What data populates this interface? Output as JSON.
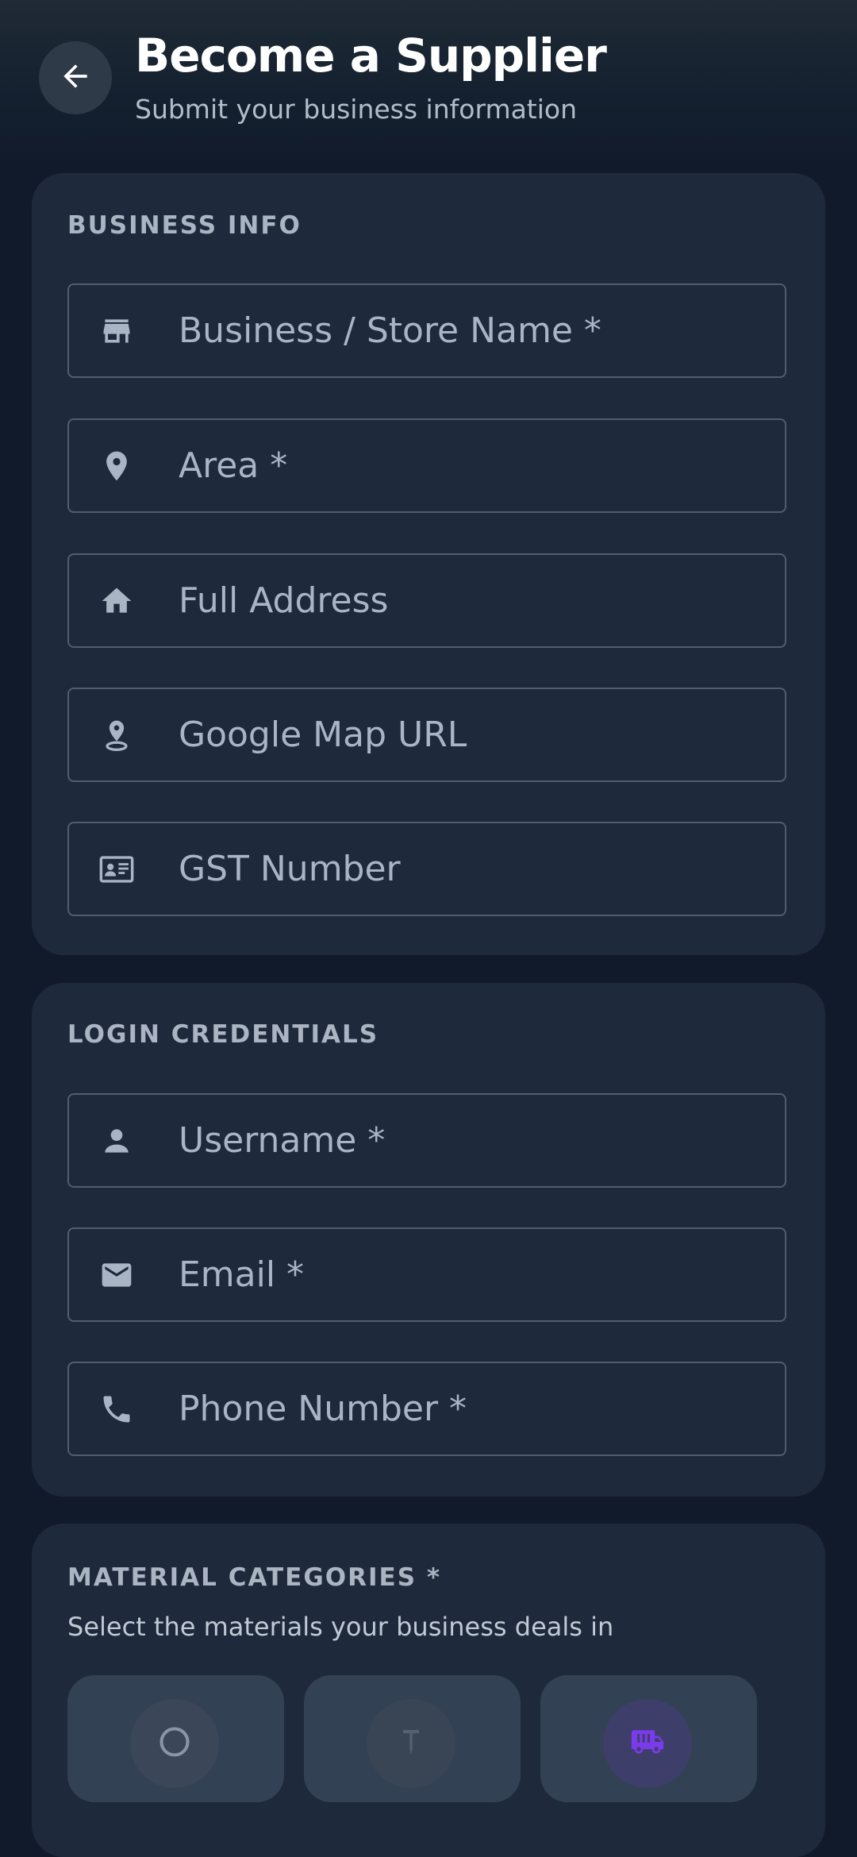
{
  "header": {
    "title": "Become a Supplier",
    "subtitle": "Submit your business information",
    "back_icon": "arrow-left-icon"
  },
  "business_info": {
    "section_title": "BUSINESS INFO",
    "fields": [
      {
        "icon": "store-icon",
        "placeholder": "Business / Store Name *"
      },
      {
        "icon": "location-pin-icon",
        "placeholder": "Area *"
      },
      {
        "icon": "home-icon",
        "placeholder": "Full Address"
      },
      {
        "icon": "map-pin-icon",
        "placeholder": "Google Map URL"
      },
      {
        "icon": "id-card-icon",
        "placeholder": "GST Number"
      }
    ]
  },
  "login_credentials": {
    "section_title": "LOGIN CREDENTIALS",
    "fields": [
      {
        "icon": "person-icon",
        "placeholder": "Username *"
      },
      {
        "icon": "email-icon",
        "placeholder": "Email *"
      },
      {
        "icon": "phone-icon",
        "placeholder": "Phone Number *"
      }
    ]
  },
  "material_categories": {
    "section_title": "MATERIAL CATEGORIES *",
    "helper": "Select the materials your business deals in",
    "tiles": [
      {
        "icon": "circle-icon"
      },
      {
        "icon": "nail-icon"
      },
      {
        "icon": "truck-icon"
      }
    ]
  },
  "colors": {
    "background": "#111a2b",
    "card": "#1e293b",
    "field_border": "#515e70",
    "placeholder": "#a9b5c4",
    "tile": "#334155",
    "accent_purple": "#7c3aed"
  }
}
